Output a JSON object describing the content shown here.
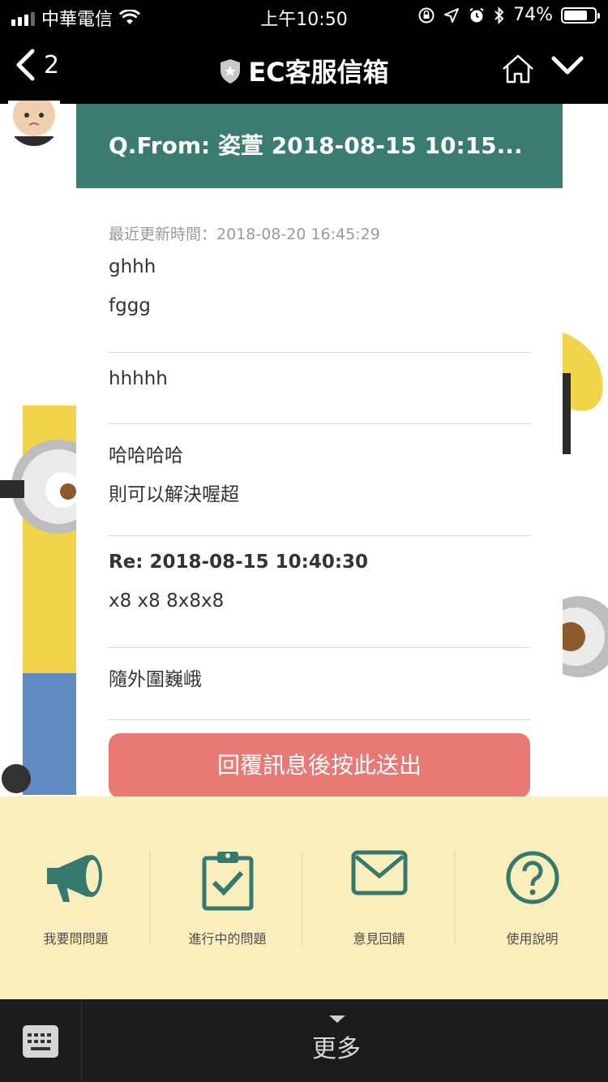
{
  "status_bar": {
    "carrier": "中華電信",
    "time": "上午10:50",
    "battery": "74%",
    "battery_level": 0.74
  },
  "nav": {
    "back_count": "2",
    "title": "EC客服信箱"
  },
  "card": {
    "header": "Q.From: 姿萱 2018-08-15 10:15...",
    "updated": "最近更新時間：2018-08-20 16:45:29",
    "messages": [
      {
        "lines": [
          "ghhh",
          "fggg"
        ]
      },
      {
        "lines": [
          "hhhhh"
        ]
      },
      {
        "lines": [
          "哈哈哈哈",
          "則可以解決喔超"
        ]
      },
      {
        "title": "Re: 2018-08-15 10:40:30",
        "lines": [
          "x8 x8 8x8x8"
        ]
      },
      {
        "lines": [
          "隨外圍巍峨"
        ]
      }
    ],
    "reply_button": "回覆訊息後按此送出"
  },
  "menu": {
    "items": [
      {
        "label": "我要問問題",
        "icon": "megaphone-icon"
      },
      {
        "label": "進行中的問題",
        "icon": "clipboard-check-icon"
      },
      {
        "label": "意見回饋",
        "icon": "envelope-icon"
      },
      {
        "label": "使用說明",
        "icon": "question-circle-icon"
      }
    ]
  },
  "bottom_bar": {
    "more_label": "更多"
  },
  "colors": {
    "header_green": "#3a7d70",
    "reply_button": "#e97975",
    "menu_bg": "#faefbc",
    "menu_icon": "#357a6c"
  }
}
